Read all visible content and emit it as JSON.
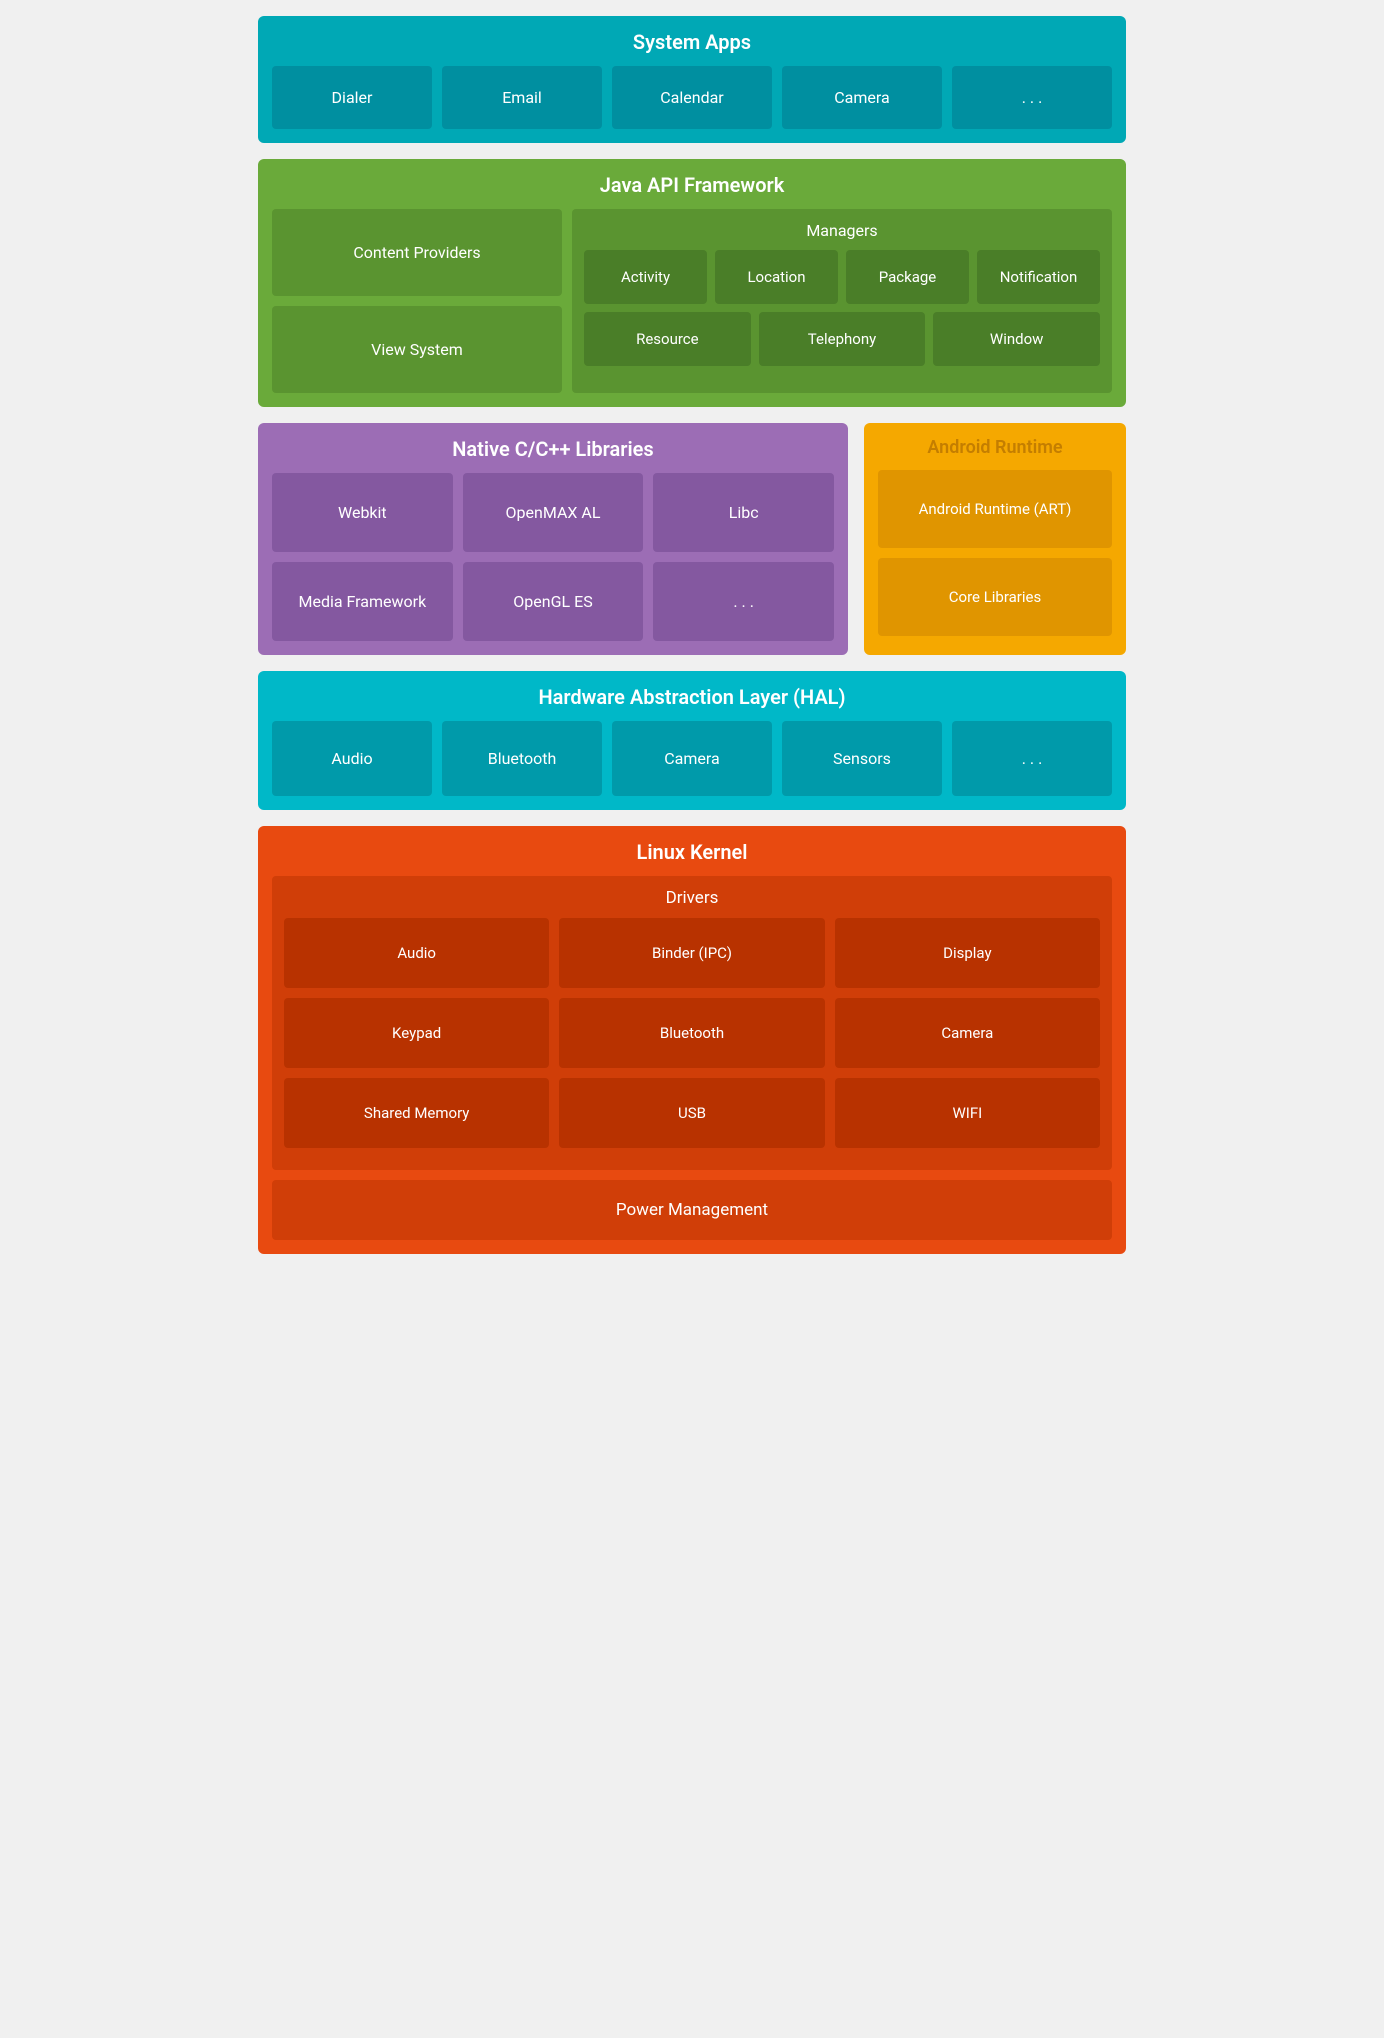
{
  "system_apps": {
    "title": "System Apps",
    "items": [
      "Dialer",
      "Email",
      "Calendar",
      "Camera",
      ". . ."
    ]
  },
  "java_api": {
    "title": "Java API Framework",
    "left": [
      "Content Providers",
      "View System"
    ],
    "managers_title": "Managers",
    "managers_row1": [
      "Activity",
      "Location",
      "Package",
      "Notification"
    ],
    "managers_row2": [
      "Resource",
      "Telephony",
      "Window"
    ]
  },
  "native_cpp": {
    "title": "Native C/C++ Libraries",
    "items": [
      "Webkit",
      "OpenMAX AL",
      "Libc",
      "Media Framework",
      "OpenGL ES",
      ". . ."
    ]
  },
  "android_runtime": {
    "title": "Android Runtime",
    "items": [
      "Android Runtime (ART)",
      "Core Libraries"
    ]
  },
  "hal": {
    "title": "Hardware Abstraction Layer (HAL)",
    "items": [
      "Audio",
      "Bluetooth",
      "Camera",
      "Sensors",
      ". . ."
    ]
  },
  "linux_kernel": {
    "title": "Linux Kernel",
    "drivers_title": "Drivers",
    "drivers": [
      "Audio",
      "Binder (IPC)",
      "Display",
      "Keypad",
      "Bluetooth",
      "Camera",
      "Shared Memory",
      "USB",
      "WIFI"
    ],
    "power_mgmt": "Power Management"
  }
}
